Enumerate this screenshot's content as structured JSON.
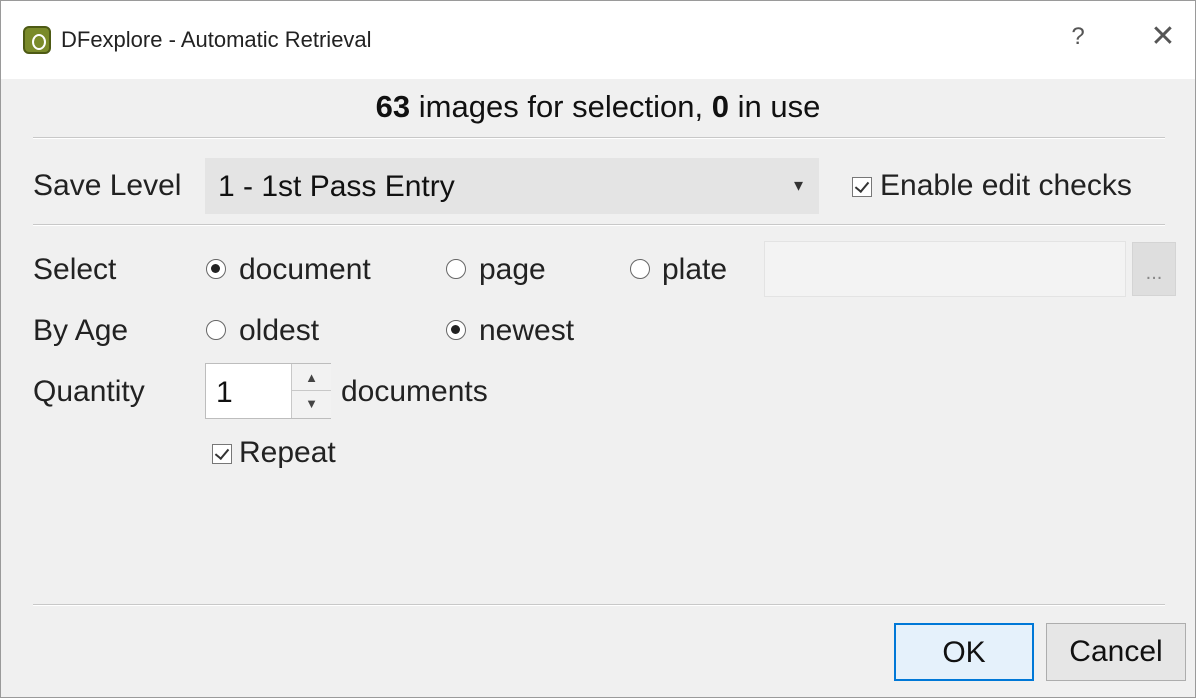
{
  "window": {
    "title": "DFexplore - Automatic Retrieval",
    "help_label": "?",
    "close_label": "✕",
    "icon": "dfexplore-app-icon"
  },
  "summary": {
    "count": "63",
    "count_text": "images for selection,",
    "in_use": "0",
    "in_use_text": "in use"
  },
  "save_level": {
    "label": "Save Level",
    "selected": "1 - 1st Pass Entry",
    "arrow": "▾"
  },
  "edit_checks": {
    "label": "Enable edit checks",
    "checked": true
  },
  "select": {
    "label": "Select",
    "options": [
      {
        "label": "document",
        "checked": true
      },
      {
        "label": "page",
        "checked": false
      },
      {
        "label": "plate",
        "checked": false
      }
    ],
    "plate_value": "",
    "browse_label": "..."
  },
  "by_age": {
    "label": "By Age",
    "options": [
      {
        "label": "oldest",
        "checked": false
      },
      {
        "label": "newest",
        "checked": true
      }
    ]
  },
  "quantity": {
    "label": "Quantity",
    "value": "1",
    "unit": "documents",
    "up_icon": "▲",
    "down_icon": "▼"
  },
  "repeat": {
    "label": "Repeat",
    "checked": true
  },
  "buttons": {
    "ok": "OK",
    "cancel": "Cancel"
  }
}
